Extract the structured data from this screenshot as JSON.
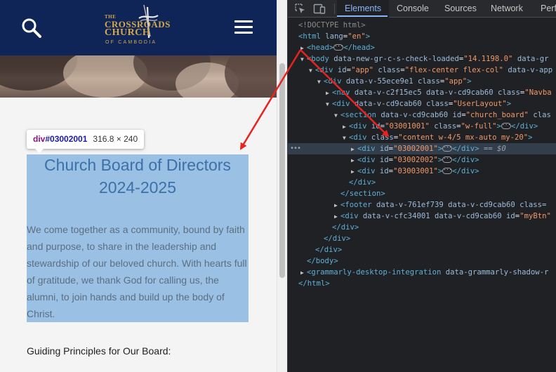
{
  "site": {
    "logo": {
      "line1": "THE",
      "line2": "CROSSROADS",
      "line3": "CHURCH",
      "line4": "OF CAMBODIA"
    },
    "title_line1": "Church Board of Directors",
    "title_line2": "2024-2025",
    "intro": "We come together as a community, bound by faith and purpose, to share in the leadership and stewardship of our beloved church. With hearts full of gratitude, we thank God for calling us, the alumni, to join hands and build up the body of Christ.",
    "guiding": "Guiding Principles for Our Board:",
    "tooltip": {
      "tag": "div",
      "id": "#03002001",
      "size": "316.8 × 240"
    }
  },
  "devtools": {
    "tabs": [
      "Elements",
      "Console",
      "Sources",
      "Network",
      "Perf"
    ],
    "active_tab": "Elements",
    "dom": {
      "doctype": "<!DOCTYPE html>",
      "html_open": {
        "tag": "<html",
        "attr": "lang",
        "val": "\"en\""
      },
      "head": {
        "open": "<head>",
        "close": "</head>"
      },
      "body": {
        "tag": "<body",
        "a1": "data-new-gr-c-s-check-loaded",
        "v1": "\"14.1198.0\"",
        "a2": "data-gr"
      },
      "app_div": {
        "tag": "<div",
        "a1": "id",
        "v1": "\"app\"",
        "a2": "class",
        "v2": "\"flex-center flex-col\"",
        "a3": "data-v-app"
      },
      "app_inner": {
        "tag": "<div",
        "a1": "data-v-55ece9e1",
        "a2": "class",
        "v2": "\"app\"",
        "end": ">"
      },
      "nav": {
        "tag": "<nav",
        "a1": "data-v-c2f15ec5",
        "a2": "data-v-cd9cab60",
        "a3": "class",
        "v3": "\"Navba"
      },
      "userlayout": {
        "tag": "<div",
        "a1": "data-v-cd9cab60",
        "a2": "class",
        "v2": "\"UserLayout\"",
        "end": ">"
      },
      "section": {
        "tag": "<section",
        "a1": "data-v-cd9cab60",
        "a2": "id",
        "v2": "\"church_board\"",
        "a3": "clas"
      },
      "div_3001001": {
        "tag": "<div",
        "a1": "id",
        "v1": "\"03001001\"",
        "a2": "class",
        "v2": "\"w-full\"",
        "close": "</div>"
      },
      "content_div": {
        "tag": "<div",
        "a1": "class",
        "v1": "\"content w-4/5 mx-auto my-20\"",
        "end": ">"
      },
      "div_03002001": {
        "tag": "<div",
        "a1": "id",
        "v1": "\"03002001\"",
        "close": "</div>",
        "eq": "== $0"
      },
      "div_03002002": {
        "tag": "<div",
        "a1": "id",
        "v1": "\"03002002\"",
        "close": "</div>"
      },
      "div_03003001": {
        "tag": "<div",
        "a1": "id",
        "v1": "\"03003001\"",
        "close": "</div>"
      },
      "close_div": "</div>",
      "close_section": "</section>",
      "footer": {
        "tag": "<footer",
        "a1": "data-v-761ef739",
        "a2": "data-v-cd9cab60",
        "a3": "class="
      },
      "mybtn": {
        "tag": "<div",
        "a1": "data-v-cfc34001",
        "a2": "data-v-cd9cab60",
        "a3": "id",
        "v3": "\"myBtn\""
      },
      "close_body": "</body>",
      "grammarly": {
        "tag": "<grammarly-desktop-integration",
        "a1": "data-grammarly-shadow-r"
      },
      "close_html": "</html>"
    }
  },
  "colors": {
    "navbar": "#0f2557",
    "logo_gold": "#d4a84a",
    "highlight": "#6fa8dc",
    "devtools_bg": "#202124",
    "tag": "#5db0d7",
    "attr": "#9bbbdc",
    "value": "#f29766",
    "arrow": "#e8231f"
  },
  "icons": [
    "search-icon",
    "hamburger-menu-icon",
    "inspect-element-icon",
    "device-toolbar-icon"
  ]
}
